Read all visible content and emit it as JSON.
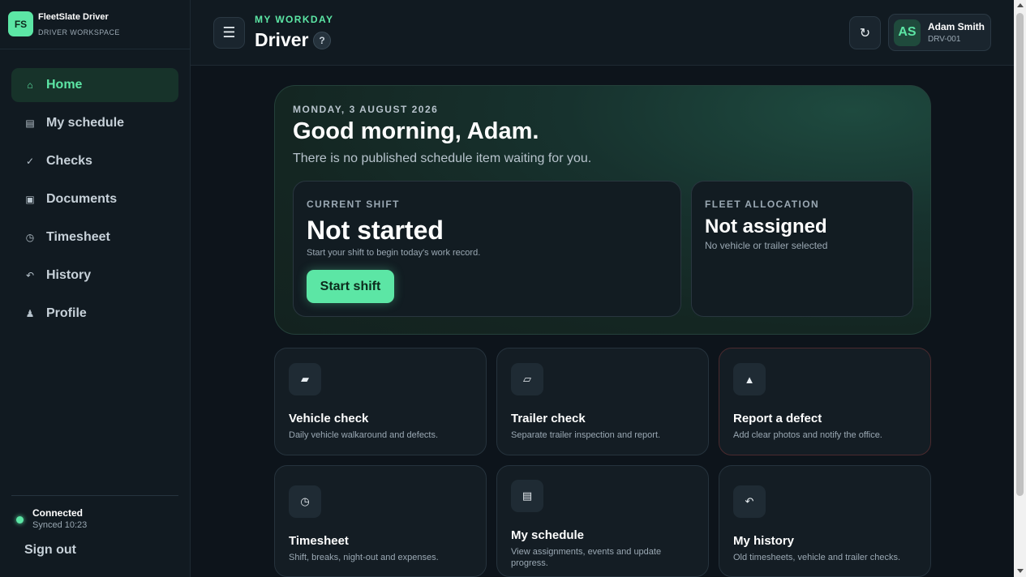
{
  "brand": {
    "logo": "FS",
    "name": "FleetSlate Driver",
    "subtitle": "DRIVER WORKSPACE"
  },
  "nav": [
    {
      "icon": "⌂",
      "label": "Home",
      "active": true
    },
    {
      "icon": "▤",
      "label": "My schedule"
    },
    {
      "icon": "✓",
      "label": "Checks"
    },
    {
      "icon": "▣",
      "label": "Documents"
    },
    {
      "icon": "◷",
      "label": "Timesheet"
    },
    {
      "icon": "↶",
      "label": "History"
    },
    {
      "icon": "♟",
      "label": "Profile"
    }
  ],
  "status": {
    "title": "Connected",
    "sub": "Synced 10:23"
  },
  "signout": "Sign out",
  "header": {
    "menu_icon": "☰",
    "eyebrow": "MY WORKDAY",
    "title": "Driver",
    "help_icon": "?",
    "refresh_icon": "↻",
    "user": {
      "initials": "AS",
      "name": "Adam Smith",
      "id": "DRV-001"
    }
  },
  "hero": {
    "date": "MONDAY, 3 AUGUST 2026",
    "greeting": "Good morning, Adam.",
    "message": "There is no published schedule item waiting for you.",
    "shift": {
      "eyebrow": "CURRENT SHIFT",
      "status": "Not started",
      "sub": "Start your shift to begin today's work record.",
      "button": "Start shift"
    },
    "fleet": {
      "eyebrow": "FLEET ALLOCATION",
      "status": "Not assigned",
      "sub": "No vehicle or trailer selected"
    }
  },
  "tiles": {
    "vehicle": {
      "icon": "▰",
      "title": "Vehicle check",
      "desc": "Daily vehicle walkaround and defects."
    },
    "trailer": {
      "icon": "▱",
      "title": "Trailer check",
      "desc": "Separate trailer inspection and report."
    },
    "defect": {
      "icon": "▲",
      "title": "Report a defect",
      "desc": "Add clear photos and notify the office."
    },
    "timesheet": {
      "icon": "◷",
      "title": "Timesheet",
      "desc": "Shift, breaks, night-out and expenses."
    },
    "schedule": {
      "icon": "▤",
      "title": "My schedule",
      "desc": "View assignments, events and update progress."
    },
    "history": {
      "icon": "↶",
      "title": "My history",
      "desc": "Old timesheets, vehicle and trailer checks."
    }
  },
  "colors": {
    "accent": "#5ce6a5",
    "background": "#0d141b",
    "surface": "#111a21"
  }
}
